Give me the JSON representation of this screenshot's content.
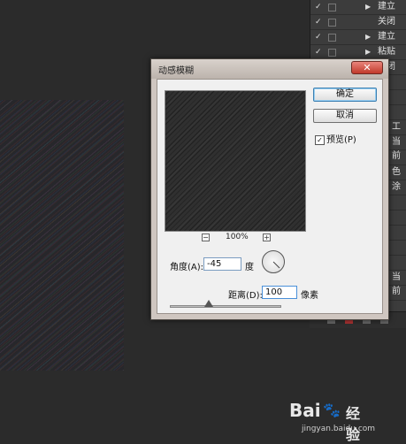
{
  "history_panel": {
    "rows": [
      {
        "text": "建立",
        "arrow": true
      },
      {
        "text": "关闭",
        "arrow": false
      },
      {
        "text": "建立",
        "arrow": true
      },
      {
        "text": "粘贴",
        "arrow": true
      },
      {
        "text": "关闭",
        "arrow": true
      }
    ],
    "partial_labels": [
      "工",
      "当前",
      "色",
      "涂",
      "当前"
    ]
  },
  "dialog": {
    "title": "动感模糊",
    "close_glyph": "✕",
    "ok_label": "确定",
    "cancel_label": "取消",
    "preview_label": "预览(P)",
    "preview_checked": true,
    "zoom_minus": "−",
    "zoom_plus": "+",
    "zoom_level": "100%",
    "angle_label": "角度(A):",
    "angle_value": "-45",
    "angle_unit": "度",
    "distance_label": "距离(D):",
    "distance_value": "100",
    "distance_unit": "像素",
    "distance_slider_fraction": 0.35
  },
  "watermark": {
    "brand": "Bai",
    "brand_suffix": "经验",
    "url": "jingyan.baidu.com"
  },
  "colors": {
    "workspace": "#2b2b2b",
    "dialog_frame": "#cfc6c0",
    "close_button": "#c0392b",
    "panel": "#3c3c3c"
  }
}
